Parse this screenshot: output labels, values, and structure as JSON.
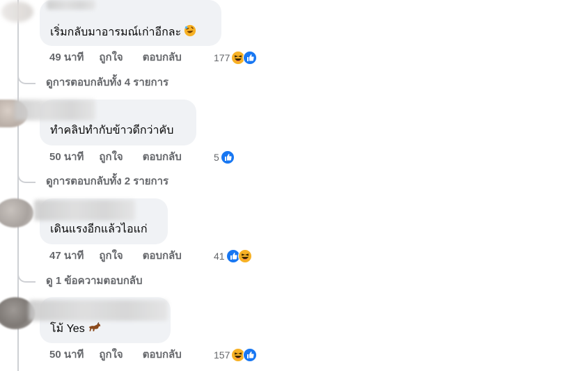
{
  "comments": [
    {
      "text": "เริ่มกลับมาอารมณ์เก่าอีกละ",
      "emoji": "rofl-emoji",
      "time": "49 นาที",
      "like": "ถูกใจ",
      "reply": "ตอบกลับ",
      "reaction_count": "177",
      "reactions": [
        "haha-icon",
        "like-icon"
      ],
      "view_replies": "ดูการตอบกลับทั้ง 4 รายการ"
    },
    {
      "text": "ทำคลิปทำกับข้าวดีกว่าคับ",
      "emoji": "",
      "time": "50 นาที",
      "like": "ถูกใจ",
      "reply": "ตอบกลับ",
      "reaction_count": "5",
      "reactions": [
        "like-icon"
      ],
      "view_replies": "ดูการตอบกลับทั้ง 2 รายการ"
    },
    {
      "text": "เดินแรงอีกแล้วไอแก่",
      "emoji": "",
      "time": "47 นาที",
      "like": "ถูกใจ",
      "reply": "ตอบกลับ",
      "reaction_count": "41",
      "reactions": [
        "like-icon",
        "haha-icon"
      ],
      "view_replies": "ดู 1 ข้อความตอบกลับ"
    },
    {
      "text": "โม้ Yes",
      "emoji": "horse-emoji",
      "time": "50 นาที",
      "like": "ถูกใจ",
      "reply": "ตอบกลับ",
      "reaction_count": "157",
      "reactions": [
        "haha-icon",
        "like-icon"
      ],
      "view_replies": ""
    }
  ],
  "colors": {
    "bubble": "#f0f2f5",
    "meta_text": "#65676b",
    "like_blue": "#1877f2",
    "haha_yellow": "#f7b125"
  }
}
